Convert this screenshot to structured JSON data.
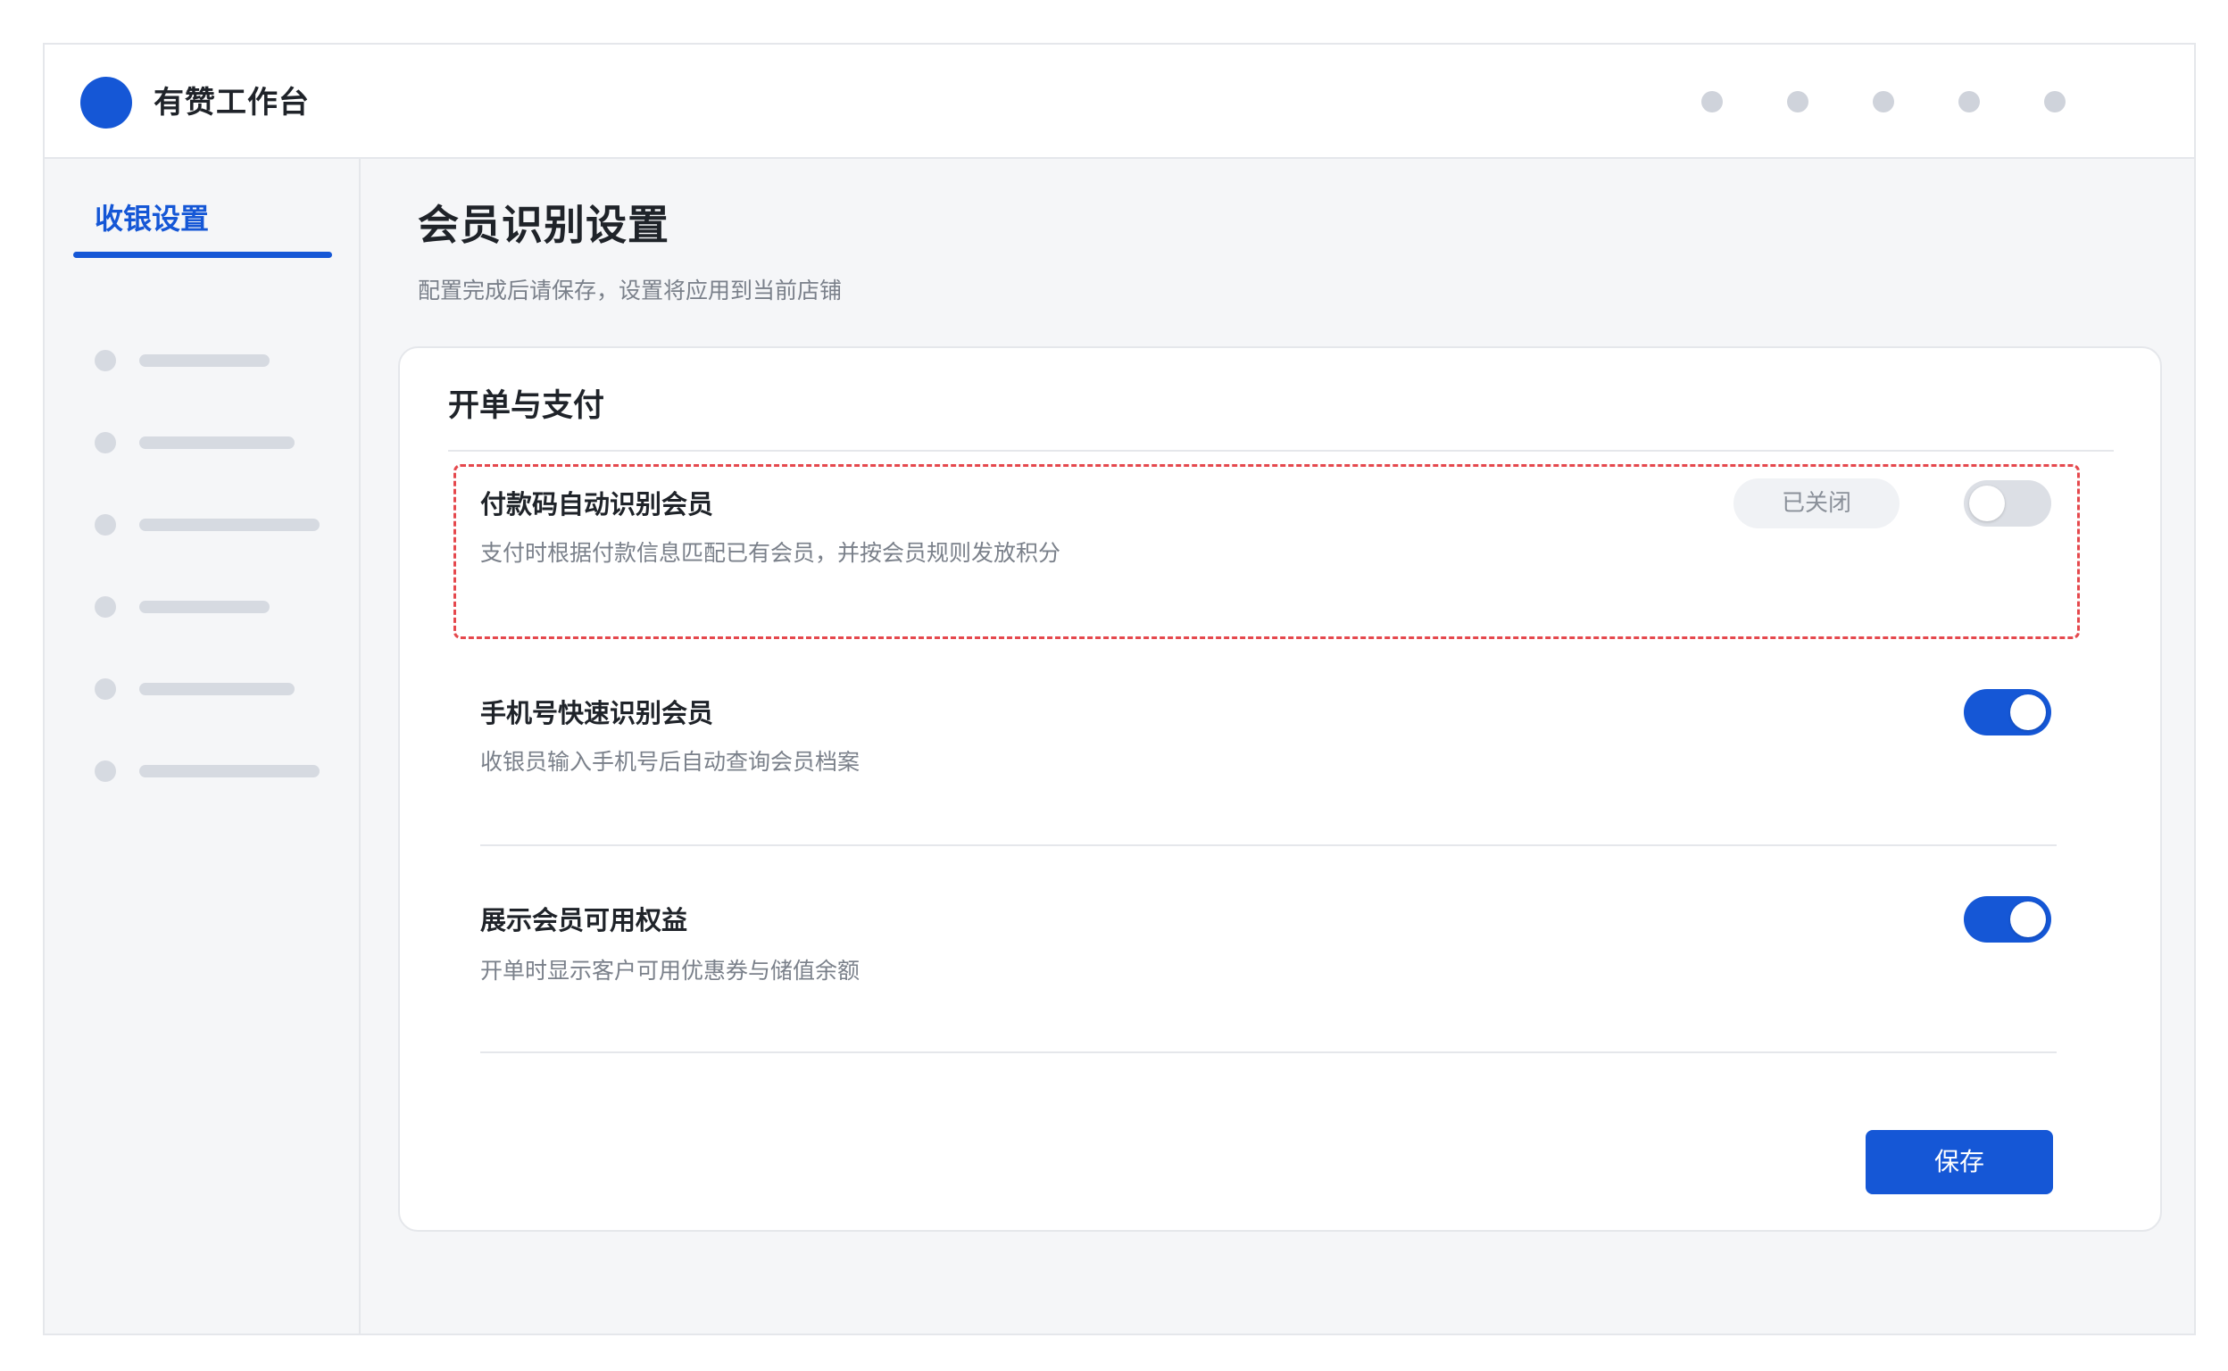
{
  "header": {
    "app_title": "有赞工作台",
    "brand_color": "#1557d6",
    "icons": [
      "dot-icon",
      "dot-icon",
      "dot-icon",
      "dot-icon",
      "dot-icon"
    ]
  },
  "sidebar": {
    "active_item_label": "收银设置",
    "placeholder_item_count": 6
  },
  "main": {
    "page_title": "会员识别设置",
    "page_subtitle": "配置完成后请保存，设置将应用到当前店铺",
    "card": {
      "title": "开单与支付",
      "settings": [
        {
          "title": "付款码自动识别会员",
          "description": "支付时根据付款信息匹配已有会员，并按会员规则发放积分",
          "status_label": "已关闭",
          "enabled": false,
          "highlighted": true
        },
        {
          "title": "手机号快速识别会员",
          "description": "收银员输入手机号后自动查询会员档案",
          "enabled": true
        },
        {
          "title": "展示会员可用权益",
          "description": "开单时显示客户可用优惠券与储值余额",
          "enabled": true
        }
      ],
      "save_label": "保存"
    }
  },
  "colors": {
    "accent": "#1557d6",
    "highlight_border": "#e5484d",
    "toggle_off": "#dcdfe5"
  }
}
